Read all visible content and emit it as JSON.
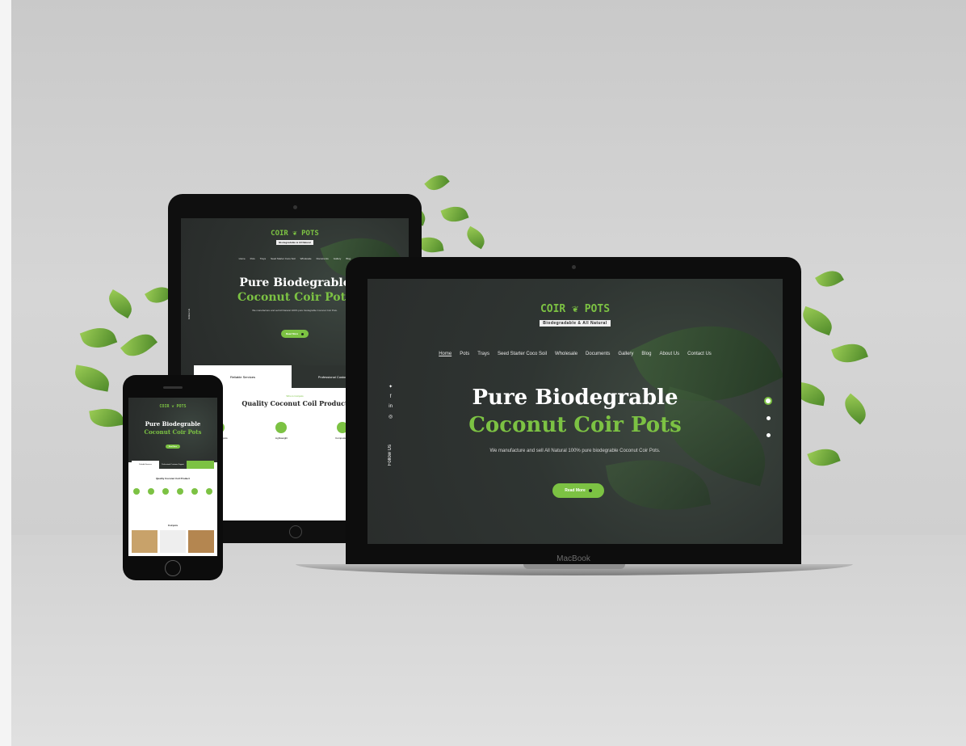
{
  "brand": {
    "logo_left": "COIR",
    "logo_right": "POTS",
    "tagline": "Biodegradable & All Natural",
    "device_label": "MacBook"
  },
  "nav": {
    "items": [
      "Home",
      "Pots",
      "Trays",
      "Seed Starter Coco Soil",
      "Wholesale",
      "Documents",
      "Gallery",
      "Blog",
      "About Us",
      "Contact Us"
    ]
  },
  "hero": {
    "title_line1": "Pure Biodegrable",
    "title_line2": "Coconut Coir Pots",
    "subtitle": "We manufacture and sell All Natural 100% pure biodegrable Coconut Coir Pots.",
    "button": "Read More",
    "follow": "Follow Us"
  },
  "social_icons": [
    "twitter-icon",
    "facebook-icon",
    "linkedin-icon",
    "instagram-icon"
  ],
  "tablet": {
    "features": [
      "Reliable Services",
      "Professional Customer Support"
    ],
    "section_kicker": "Who is Coirpots",
    "section_title": "Quality Coconut Coil Product",
    "benefits": [
      "Nutrients in pots",
      "Lightweight",
      "Compostable",
      "Natural"
    ]
  },
  "phone": {
    "section_title": "Quality Coconut Coil Product",
    "products_title": "Coirpots"
  },
  "colors": {
    "accent": "#7cc243",
    "dark_bg": "#2e3330",
    "wall": "#d0d0d0"
  }
}
